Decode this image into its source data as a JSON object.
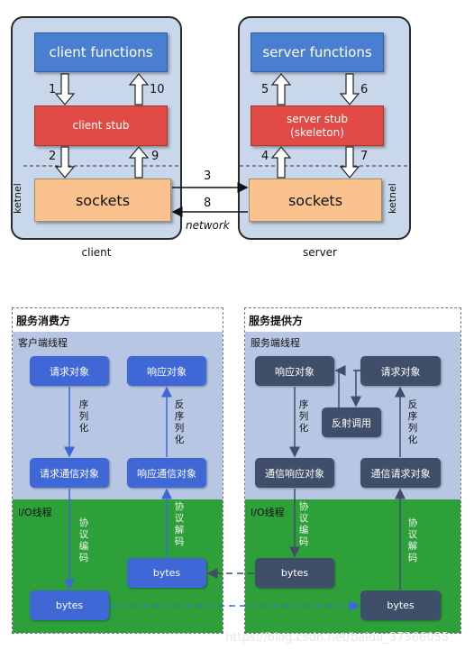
{
  "rpc": {
    "client": {
      "functions": "client functions",
      "stub": "client stub",
      "sockets": "sockets",
      "side_label": "ketnel",
      "caption": "client"
    },
    "server": {
      "functions": "server functions",
      "stub_line1": "server stub",
      "stub_line2": "(skeleton)",
      "sockets": "sockets",
      "side_label": "ketnel",
      "caption": "server"
    },
    "steps": [
      "1",
      "2",
      "3",
      "4",
      "5",
      "6",
      "7",
      "8",
      "9",
      "10"
    ],
    "network_label": "network"
  },
  "flow": {
    "consumer": {
      "title": "服务消费方",
      "client_thread": "客户端线程",
      "io_thread": "I/O线程",
      "request_object": "请求对象",
      "response_object": "响应对象",
      "request_comm_object": "请求通信对象",
      "response_comm_object": "响应通信对象",
      "serialize": [
        "序",
        "列",
        "化"
      ],
      "deserialize": [
        "反",
        "序",
        "列",
        "化"
      ],
      "encode": [
        "协",
        "议",
        "编",
        "码"
      ],
      "decode": [
        "协",
        "议",
        "解",
        "码"
      ],
      "bytes_out": "bytes",
      "bytes_in": "bytes"
    },
    "provider": {
      "title": "服务提供方",
      "server_thread": "服务端线程",
      "io_thread": "I/O线程",
      "response_object": "响应对象",
      "request_object": "请求对象",
      "reflection_call": "反射调用",
      "response_comm_object": "通信响应对象",
      "request_comm_object": "通信请求对象",
      "serialize": [
        "序",
        "列",
        "化"
      ],
      "deserialize": [
        "反",
        "序",
        "列",
        "化"
      ],
      "encode": [
        "协",
        "议",
        "编",
        "码"
      ],
      "decode": [
        "协",
        "议",
        "解",
        "码"
      ],
      "bytes_out": "bytes",
      "bytes_in": "bytes"
    }
  },
  "watermark": "https://blog.csdn.net/baidu_37366055"
}
